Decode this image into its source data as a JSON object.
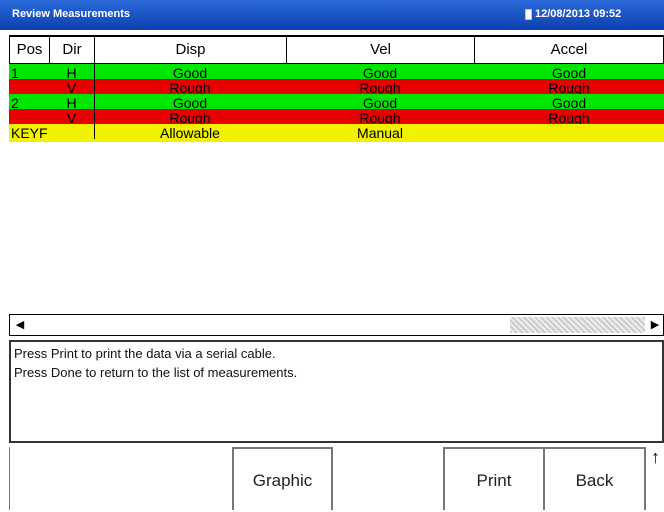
{
  "titlebar": {
    "title": "Review Measurements",
    "clock": "12/08/2013 09:52"
  },
  "table": {
    "columns": [
      "Pos",
      "Dir",
      "Disp",
      "Vel",
      "Accel"
    ],
    "rows": [
      {
        "pos": "1",
        "dir": "H",
        "disp": "Good",
        "vel": "Good",
        "accel": "Good",
        "color": "#00e600"
      },
      {
        "pos": "",
        "dir": "V",
        "disp": "Rough",
        "vel": "Rough",
        "accel": "Rough",
        "color": "#e60000"
      },
      {
        "pos": "2",
        "dir": "H",
        "disp": "Good",
        "vel": "Good",
        "accel": "Good",
        "color": "#00e600"
      },
      {
        "pos": "",
        "dir": "V",
        "disp": "Rough",
        "vel": "Rough",
        "accel": "Rough",
        "color": "#e60000"
      },
      {
        "pos": "KEYF",
        "dir": "",
        "disp": "Allowable",
        "vel": "Manual",
        "accel": "",
        "color": "#f2f200"
      }
    ]
  },
  "scroll": {
    "left_arrow": "◀",
    "right_arrow": "▶"
  },
  "message": {
    "line1": "Press Print to print the data via a serial cable.",
    "line2": "Press Done to return to the list of measurements."
  },
  "buttons": {
    "graphic": "Graphic",
    "print": "Print",
    "back": "Back",
    "arrow": "↑"
  }
}
